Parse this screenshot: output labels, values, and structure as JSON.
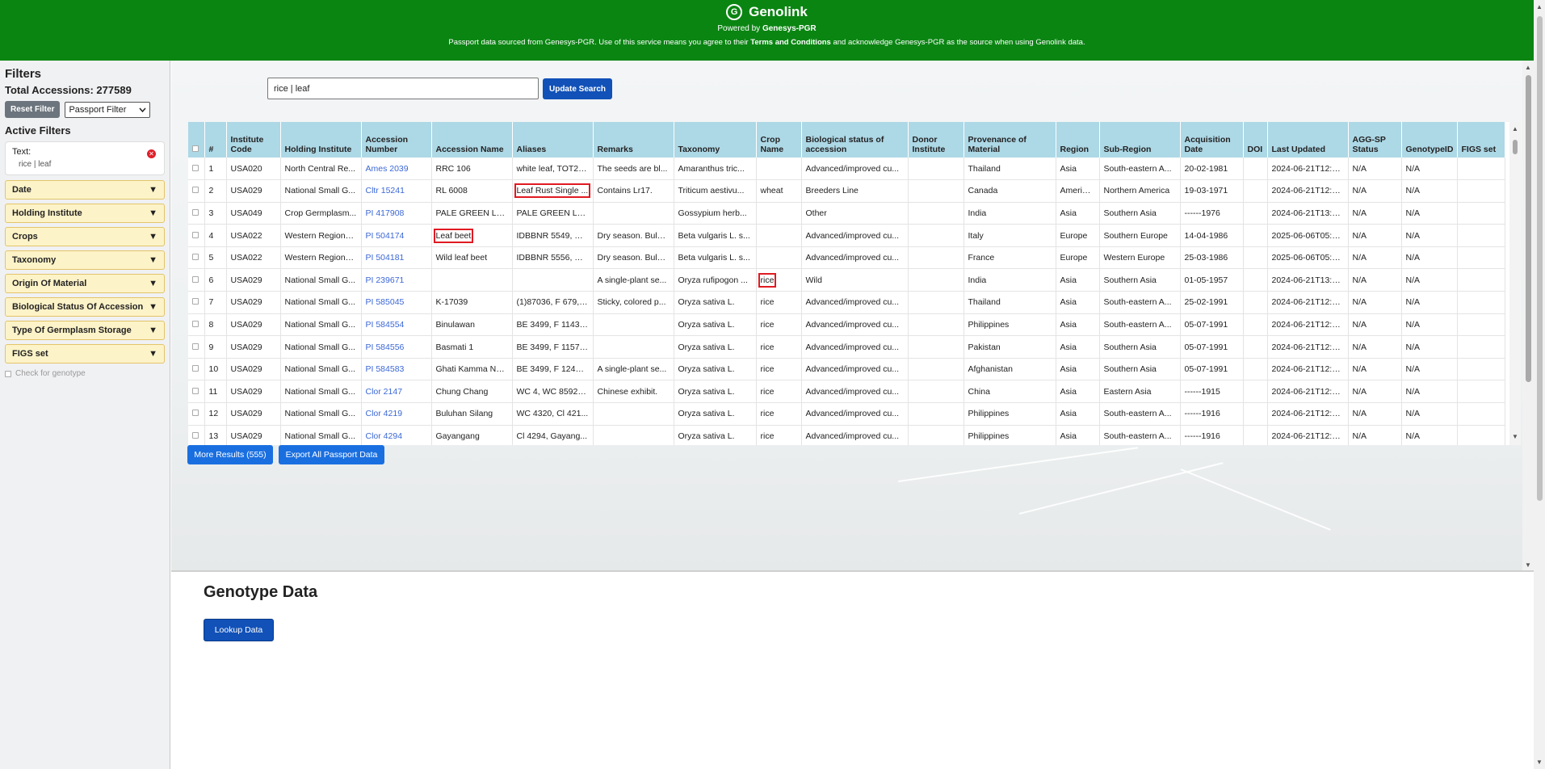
{
  "header": {
    "app_name": "Genolink",
    "powered_prefix": "Powered by ",
    "powered_name": "Genesys-PGR",
    "notice_part1": "Passport data sourced from Genesys-PGR. Use of this service means you agree to their ",
    "notice_terms": "Terms and Conditions",
    "notice_part2": " and acknowledge Genesys-PGR as the source when using Genolink data."
  },
  "sidebar": {
    "title": "Filters",
    "total_label": "Total Accessions: 277589",
    "reset_label": "Reset Filter",
    "filter_select": "Passport Filter",
    "active_title": "Active Filters",
    "active_filter": {
      "label": "Text:",
      "value": "rice | leaf"
    },
    "facets": [
      "Date",
      "Holding Institute",
      "Crops",
      "Taxonomy",
      "Origin Of Material",
      "Biological Status Of Accession",
      "Type Of Germplasm Storage",
      "FIGS set"
    ],
    "genotype_check": "Check for genotype"
  },
  "search": {
    "value": "rice | leaf",
    "button": "Update Search"
  },
  "table": {
    "headers": [
      "#",
      "Institute Code",
      "Holding Institute",
      "Accession Number",
      "Accession Name",
      "Aliases",
      "Remarks",
      "Taxonomy",
      "Crop Name",
      "Biological status of accession",
      "Donor Institute",
      "Provenance of Material",
      "Region",
      "Sub-Region",
      "Acquisition Date",
      "DOI",
      "Last Updated",
      "AGG-SP Status",
      "GenotypeID",
      "FIGS set"
    ],
    "rows": [
      [
        "1",
        "USA020",
        "North Central Re...",
        "Ames 2039",
        "RRC 106",
        "white leaf, TOT23...",
        "The seeds are bl...",
        "Amaranthus tric...",
        "",
        "Advanced/improved cu...",
        "",
        "Thailand",
        "Asia",
        "South-eastern A...",
        "20-02-1981",
        "",
        "2024-06-21T12:4...",
        "N/A",
        "N/A",
        ""
      ],
      [
        "2",
        "USA029",
        "National Small G...",
        "Cltr 15241",
        "RL 6008",
        "Leaf Rust Single ...",
        "Contains Lr17.",
        "Triticum aestivu...",
        "wheat",
        "Breeders Line",
        "",
        "Canada",
        "Americas",
        "Northern America",
        "19-03-1971",
        "",
        "2024-06-21T12:4...",
        "N/A",
        "N/A",
        ""
      ],
      [
        "3",
        "USA049",
        "Crop Germplasm...",
        "PI 417908",
        "PALE GREEN LEAF",
        "PALE GREEN LEAF",
        "",
        "Gossypium herb...",
        "",
        "Other",
        "",
        "India",
        "Asia",
        "Southern Asia",
        "------1976",
        "",
        "2024-06-21T13:1...",
        "N/A",
        "N/A",
        ""
      ],
      [
        "4",
        "USA022",
        "Western Regiona...",
        "PI 504174",
        "Leaf beet",
        "IDBBNR 5549, W...",
        "Dry season. Bulk ...",
        "Beta vulgaris L. s...",
        "",
        "Advanced/improved cu...",
        "",
        "Italy",
        "Europe",
        "Southern Europe",
        "14-04-1986",
        "",
        "2025-06-06T05:3...",
        "N/A",
        "N/A",
        ""
      ],
      [
        "5",
        "USA022",
        "Western Regiona...",
        "PI 504181",
        "Wild leaf beet",
        "IDBBNR 5556, W...",
        "Dry season. Bulk ...",
        "Beta vulgaris L. s...",
        "",
        "Advanced/improved cu...",
        "",
        "France",
        "Europe",
        "Western Europe",
        "25-03-1986",
        "",
        "2025-06-06T05:3...",
        "N/A",
        "N/A",
        ""
      ],
      [
        "6",
        "USA029",
        "National Small G...",
        "PI 239671",
        "",
        "",
        "A single-plant se...",
        "Oryza rufipogon ...",
        "rice",
        "Wild",
        "",
        "India",
        "Asia",
        "Southern Asia",
        "01-05-1957",
        "",
        "2024-06-21T13:4...",
        "N/A",
        "N/A",
        ""
      ],
      [
        "7",
        "USA029",
        "National Small G...",
        "PI 585045",
        "K-17039",
        "(1)87036, F 679, ...",
        "Sticky, colored p...",
        "Oryza sativa L.",
        "rice",
        "Advanced/improved cu...",
        "",
        "Thailand",
        "Asia",
        "South-eastern A...",
        "25-02-1991",
        "",
        "2024-06-21T12:4...",
        "N/A",
        "N/A",
        ""
      ],
      [
        "8",
        "USA029",
        "National Small G...",
        "PI 584554",
        "Binulawan",
        "BE 3499, F 1143, ...",
        "",
        "Oryza sativa L.",
        "rice",
        "Advanced/improved cu...",
        "",
        "Philippines",
        "Asia",
        "South-eastern A...",
        "05-07-1991",
        "",
        "2024-06-21T12:4...",
        "N/A",
        "N/A",
        ""
      ],
      [
        "9",
        "USA029",
        "National Small G...",
        "PI 584556",
        "Basmati 1",
        "BE 3499, F 1157, ...",
        "",
        "Oryza sativa L.",
        "rice",
        "Advanced/improved cu...",
        "",
        "Pakistan",
        "Asia",
        "Southern Asia",
        "05-07-1991",
        "",
        "2024-06-21T12:4...",
        "N/A",
        "N/A",
        ""
      ],
      [
        "10",
        "USA029",
        "National Small G...",
        "PI 584583",
        "Ghati Kamma Na...",
        "BE 3499, F 1241, ...",
        "A single-plant se...",
        "Oryza sativa L.",
        "rice",
        "Advanced/improved cu...",
        "",
        "Afghanistan",
        "Asia",
        "Southern Asia",
        "05-07-1991",
        "",
        "2024-06-21T12:4...",
        "N/A",
        "N/A",
        ""
      ],
      [
        "11",
        "USA029",
        "National Small G...",
        "Clor 2147",
        "Chung Chang",
        "WC 4, WC 8592, ...",
        "Chinese exhibit.",
        "Oryza sativa L.",
        "rice",
        "Advanced/improved cu...",
        "",
        "China",
        "Asia",
        "Eastern Asia",
        "------1915",
        "",
        "2024-06-21T12:4...",
        "N/A",
        "N/A",
        ""
      ],
      [
        "12",
        "USA029",
        "National Small G...",
        "Clor 4219",
        "Buluhan Silang",
        "WC 4320, Cl 421...",
        "",
        "Oryza sativa L.",
        "rice",
        "Advanced/improved cu...",
        "",
        "Philippines",
        "Asia",
        "South-eastern A...",
        "------1916",
        "",
        "2024-06-21T12:4...",
        "N/A",
        "N/A",
        ""
      ],
      [
        "13",
        "USA029",
        "National Small G...",
        "Clor 4294",
        "Gayangang",
        "Cl 4294, Gayang...",
        "",
        "Oryza sativa L.",
        "rice",
        "Advanced/improved cu...",
        "",
        "Philippines",
        "Asia",
        "South-eastern A...",
        "------1916",
        "",
        "2024-06-21T12:4...",
        "N/A",
        "N/A",
        ""
      ]
    ]
  },
  "actions": {
    "more_results": "More Results (555)",
    "export": "Export All Passport Data"
  },
  "genotype": {
    "title": "Genotype Data",
    "lookup": "Lookup Data"
  },
  "colors": {
    "header_bg": "#0a8512",
    "table_header_bg": "#add8e6",
    "primary_button": "#1151b8",
    "facet_bg": "#fdf3c8",
    "highlight": "#e01a22",
    "link": "#3b67d6"
  }
}
